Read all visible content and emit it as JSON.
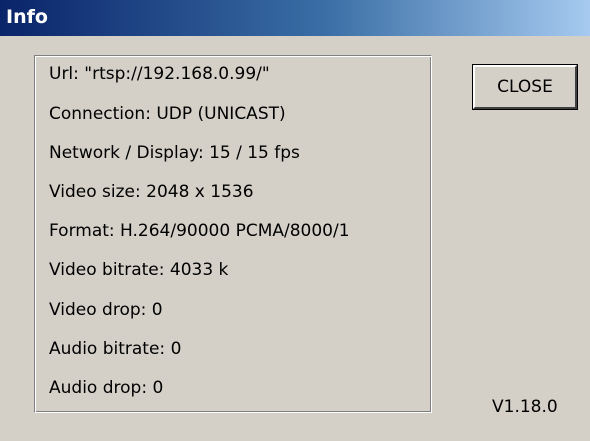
{
  "window": {
    "title": "Info"
  },
  "info": {
    "lines": [
      "Url: \"rtsp://192.168.0.99/\"",
      "Connection: UDP (UNICAST)",
      "Network / Display:  15 / 15 fps",
      "Video size: 2048 x 1536",
      "Format: H.264/90000 PCMA/8000/1",
      "Video bitrate: 4033 k",
      "Video drop: 0",
      "Audio bitrate: 0",
      "Audio drop: 0"
    ]
  },
  "buttons": {
    "close_label": "CLOSE"
  },
  "footer": {
    "version": "V1.18.0"
  },
  "colors": {
    "window_bg": "#d4d0c8",
    "titlebar_start": "#0a246a",
    "titlebar_end": "#a6caf0",
    "title_text": "#ffffff"
  }
}
